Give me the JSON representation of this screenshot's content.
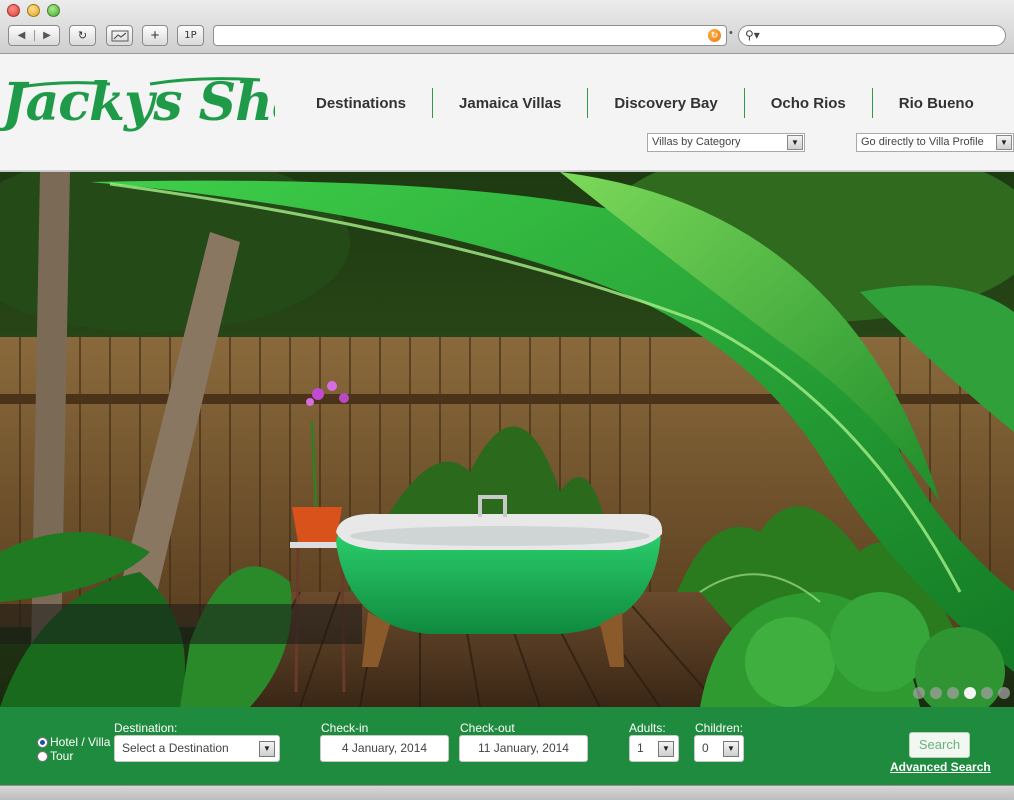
{
  "browser": {
    "back_icon": "◀",
    "forward_icon": "▶",
    "reload_icon": "↻",
    "add_bookmark_icon": "+",
    "password_label": "1P",
    "url": "",
    "search_placeholder": ""
  },
  "site": {
    "logo_text": "Jackys Shack",
    "brand_color": "#1f9a48",
    "nav": {
      "destinations": "Destinations",
      "jamaica_villas": "Jamaica Villas",
      "discovery_bay": "Discovery Bay",
      "ocho_rios": "Ocho Rios",
      "rio_bueno": "Rio Bueno"
    },
    "villas_by_category": "Villas by Category",
    "go_directly": "Go directly to Villa Profile"
  },
  "hero": {
    "slides": 6,
    "active_slide": 4
  },
  "booking": {
    "option_hotel": "Hotel / Villa",
    "option_tour": "Tour",
    "destination_label": "Destination:",
    "destination_value": "Select a Destination",
    "checkin_label": "Check-in",
    "checkin_value": "4 January, 2014",
    "checkout_label": "Check-out",
    "checkout_value": "11 January, 2014",
    "adults_label": "Adults:",
    "adults_value": "1",
    "children_label": "Children:",
    "children_value": "0",
    "search_label": "Search",
    "advanced_search": "Advanced Search",
    "bar_color": "#1f8b3e"
  }
}
